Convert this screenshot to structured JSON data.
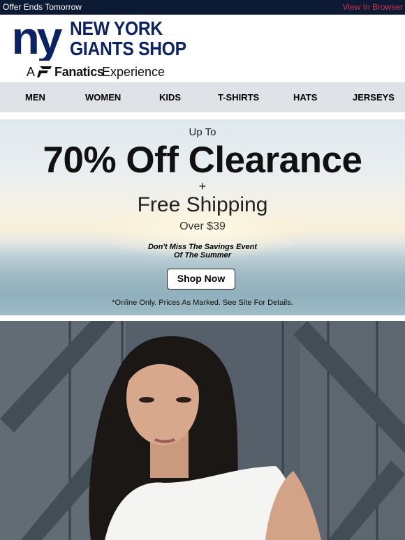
{
  "topbar": {
    "offer_text": "Offer Ends Tomorrow",
    "view_link": "View In Browser"
  },
  "brand": {
    "logo_letters": "ny",
    "shop_name_line1": "NEW YORK",
    "shop_name_line2": "GIANTS SHOP",
    "tagline_a": "A",
    "tagline_brand": "Fanatics",
    "tagline_rest": "Experience"
  },
  "nav": {
    "items": [
      "MEN",
      "WOMEN",
      "KIDS",
      "T-SHIRTS",
      "HATS",
      "JERSEYS"
    ]
  },
  "hero": {
    "up_to": "Up To",
    "headline": "70% Off Clearance",
    "plus": "+",
    "free_shipping": "Free Shipping",
    "over": "Over $39",
    "subline1": "Don't Miss The Savings Event",
    "subline2": "Of The Summer",
    "cta_label": "Shop Now",
    "fine_print": "*Online Only. Prices As Marked. See Site For Details."
  },
  "colors": {
    "navy": "#0b2265",
    "topbar_bg": "#0c1b33",
    "link_red": "#d6304b",
    "nav_bg": "#dfe3e7"
  }
}
